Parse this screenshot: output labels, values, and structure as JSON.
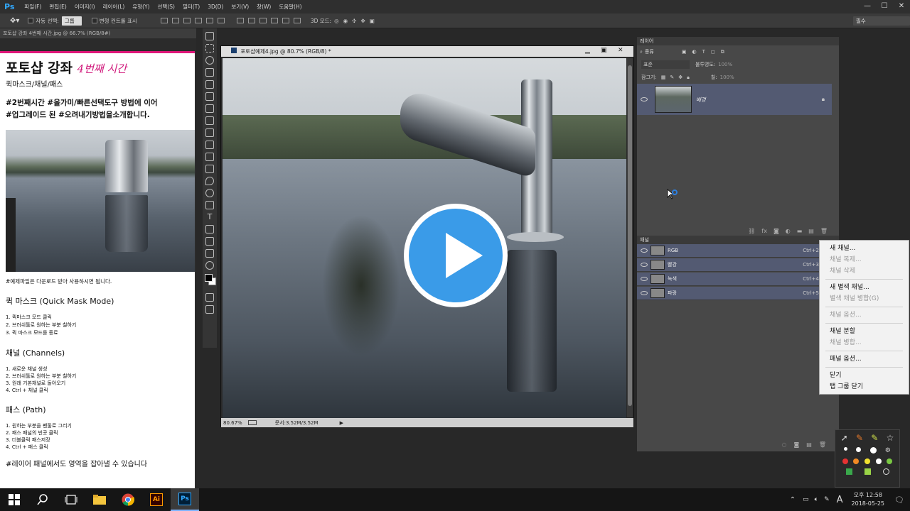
{
  "app": {
    "logo": "Ps",
    "menus": [
      "파일(F)",
      "편집(E)",
      "이미지(I)",
      "레이어(L)",
      "유형(Y)",
      "선택(S)",
      "필터(T)",
      "3D(D)",
      "보기(V)",
      "창(W)",
      "도움말(H)"
    ],
    "window_controls": [
      "—",
      "☐",
      "✕"
    ]
  },
  "options": {
    "auto_select": "자동 선택:",
    "auto_select_value": "그룹",
    "transform": "변형 컨트롤 표시",
    "mode3d": "3D 모드:",
    "workspace": "필수"
  },
  "left_doc": {
    "tab": "포토샵 강좌 4번째 시간.jpg @ 66.7% (RGB/8#)",
    "title": "포토샵 강좌",
    "subtitle_script": "4번째 시간",
    "subtitle": "퀵마스크/채널/패스",
    "intro": [
      "#2번째시간 #올가미/빠른선택도구 방법에 이어",
      "#업그레이드 된 #오려내기방법을소개합니다."
    ],
    "note": "#예제파일은 다운로드 받아 사용하시면 됩니다.",
    "sections": [
      {
        "title": "퀵 마스크 (Quick Mask Mode)",
        "items": [
          "1. 퀵마스크 모드 클릭",
          "2. 브러쉬툴로 원하는 부분 칠하기",
          "3. 퀵 마스크 모드를 종료"
        ]
      },
      {
        "title": "채널 (Channels)",
        "items": [
          "1. 새로운 채널 생성",
          "2. 브러쉬툴로 원하는 부분 칠하기",
          "3. 원래 기본채널로 돌아오기",
          "4. Ctrl + 채널 클릭"
        ]
      },
      {
        "title": "패스 (Path)",
        "items": [
          "1. 원하는 부분을 펜툴로 그리기",
          "2. 패스 패널의 빈곳 클릭",
          "3. 더블클릭 패스저장",
          "4. Ctrl + 패스 클릭"
        ]
      }
    ],
    "footer": "#레이어 패널에서도 영역을 잡아낼 수 있습니다"
  },
  "doc": {
    "title": "포토샵예제4.jpg @ 80.7% (RGB/8) *",
    "zoom": "80.67%",
    "doc_size": "문서:3.52M/3.52M"
  },
  "layers_panel": {
    "tab": "레이어",
    "kind": "종류",
    "blend": "표준",
    "opacity_label": "불투명도:",
    "opacity": "100%",
    "lock_label": "잠그기:",
    "fill_label": "칠:",
    "fill": "100%",
    "layer_name": "배경"
  },
  "channels_panel": {
    "tab": "채널",
    "rows": [
      {
        "name": "RGB",
        "shortcut": "Ctrl+2"
      },
      {
        "name": "빨강",
        "shortcut": "Ctrl+3"
      },
      {
        "name": "녹색",
        "shortcut": "Ctrl+4"
      },
      {
        "name": "파랑",
        "shortcut": "Ctrl+5"
      }
    ]
  },
  "context_menu": {
    "items": [
      {
        "label": "새 채널...",
        "disabled": false
      },
      {
        "label": "채널 복제...",
        "disabled": true
      },
      {
        "label": "채널 삭제",
        "disabled": true
      },
      {
        "sep": true
      },
      {
        "label": "새 별색 채널...",
        "disabled": false
      },
      {
        "label": "별색 채널 병합(G)",
        "disabled": true
      },
      {
        "sep": true
      },
      {
        "label": "채널 옵션...",
        "disabled": true
      },
      {
        "sep": true
      },
      {
        "label": "채널 분할",
        "disabled": false
      },
      {
        "label": "채널 병합...",
        "disabled": true
      },
      {
        "sep": true
      },
      {
        "label": "패널 옵션...",
        "disabled": false
      },
      {
        "sep": true
      },
      {
        "label": "닫기",
        "disabled": false
      },
      {
        "label": "탭 그룹 닫기",
        "disabled": false
      }
    ]
  },
  "taskbar": {
    "time": "오후 12:58",
    "date": "2018-05-25",
    "ime": "A"
  },
  "colors": {
    "accent": "#31a8ff",
    "play": "#3a9be8",
    "pink": "#e0177a",
    "selected_row": "#535a72"
  }
}
